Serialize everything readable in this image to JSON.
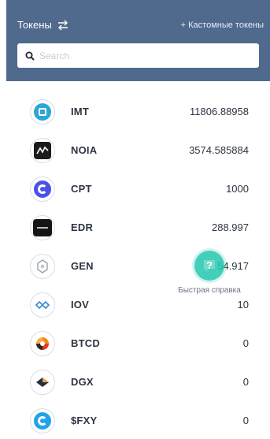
{
  "header": {
    "title": "Токены",
    "custom_tokens_link": "+ Кастомные токены"
  },
  "search": {
    "placeholder": "Search",
    "value": ""
  },
  "tokens": [
    {
      "symbol": "IMT",
      "balance": "11806.88958"
    },
    {
      "symbol": "NOIA",
      "balance": "3574.585884"
    },
    {
      "symbol": "CPT",
      "balance": "1000"
    },
    {
      "symbol": "EDR",
      "balance": "288.997"
    },
    {
      "symbol": "GEN",
      "balance": "54.917"
    },
    {
      "symbol": "IOV",
      "balance": "10"
    },
    {
      "symbol": "BTCD",
      "balance": "0"
    },
    {
      "symbol": "DGX",
      "balance": "0"
    },
    {
      "symbol": "$FXY",
      "balance": "0"
    }
  ],
  "help": {
    "label": "Быстрая справка"
  },
  "colors": {
    "header_bg": "#4f6a8c",
    "help_bg": "#24c7b0"
  }
}
